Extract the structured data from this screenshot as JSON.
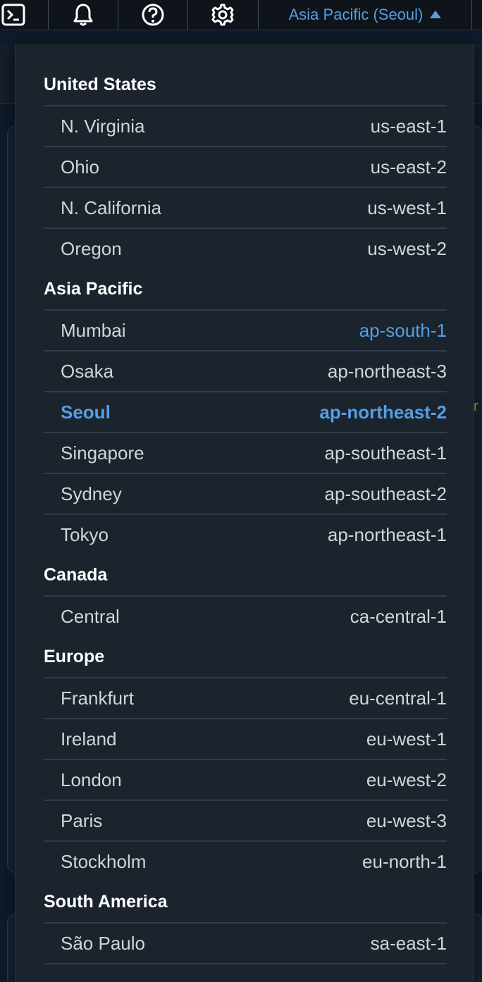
{
  "header": {
    "region_label": "Asia Pacific (Seoul)"
  },
  "colors": {
    "accent": "#539fe5",
    "text": "#d1d5db",
    "dropdown_bg": "#1b232d"
  },
  "region_groups": [
    {
      "label": "United States",
      "regions": [
        {
          "name": "N. Virginia",
          "code": "us-east-1"
        },
        {
          "name": "Ohio",
          "code": "us-east-2"
        },
        {
          "name": "N. California",
          "code": "us-west-1"
        },
        {
          "name": "Oregon",
          "code": "us-west-2"
        }
      ]
    },
    {
      "label": "Asia Pacific",
      "regions": [
        {
          "name": "Mumbai",
          "code": "ap-south-1"
        },
        {
          "name": "Osaka",
          "code": "ap-northeast-3"
        },
        {
          "name": "Seoul",
          "code": "ap-northeast-2"
        },
        {
          "name": "Singapore",
          "code": "ap-southeast-1"
        },
        {
          "name": "Sydney",
          "code": "ap-southeast-2"
        },
        {
          "name": "Tokyo",
          "code": "ap-northeast-1"
        }
      ]
    },
    {
      "label": "Canada",
      "regions": [
        {
          "name": "Central",
          "code": "ca-central-1"
        }
      ]
    },
    {
      "label": "Europe",
      "regions": [
        {
          "name": "Frankfurt",
          "code": "eu-central-1"
        },
        {
          "name": "Ireland",
          "code": "eu-west-1"
        },
        {
          "name": "London",
          "code": "eu-west-2"
        },
        {
          "name": "Paris",
          "code": "eu-west-3"
        },
        {
          "name": "Stockholm",
          "code": "eu-north-1"
        }
      ]
    },
    {
      "label": "South America",
      "regions": [
        {
          "name": "São Paulo",
          "code": "sa-east-1"
        }
      ]
    }
  ]
}
